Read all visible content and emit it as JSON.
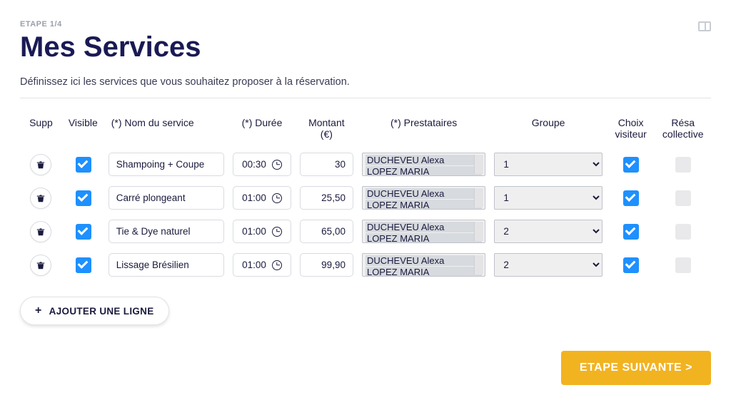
{
  "step_label": "ETAPE 1/4",
  "page_title": "Mes Services",
  "subtitle": "Définissez ici les services que vous souhaitez proposer à la réservation.",
  "columns": {
    "supp": "Supp",
    "visible": "Visible",
    "nom": "(*) Nom du service",
    "duree": "(*) Durée",
    "montant_l1": "Montant",
    "montant_l2": "(€)",
    "prestataires": "(*) Prestataires",
    "groupe": "Groupe",
    "choix_l1": "Choix",
    "choix_l2": "visiteur",
    "resa_l1": "Résa",
    "resa_l2": "collective"
  },
  "groupe_options": [
    "1",
    "2"
  ],
  "prestataires_options": [
    "DUCHEVEU Alexa",
    "LOPEZ MARIA"
  ],
  "rows": [
    {
      "visible": true,
      "nom": "Shampoing + Coupe",
      "duree": "00:30",
      "montant": "30",
      "prestataires": [
        "DUCHEVEU Alexa",
        "LOPEZ MARIA"
      ],
      "groupe": "1",
      "choix_visiteur": true,
      "resa_collective": false
    },
    {
      "visible": true,
      "nom": "Carré plongeant",
      "duree": "01:00",
      "montant": "25,50",
      "prestataires": [
        "DUCHEVEU Alexa",
        "LOPEZ MARIA"
      ],
      "groupe": "1",
      "choix_visiteur": true,
      "resa_collective": false
    },
    {
      "visible": true,
      "nom": "Tie & Dye naturel",
      "duree": "01:00",
      "montant": "65,00",
      "prestataires": [
        "DUCHEVEU Alexa",
        "LOPEZ MARIA"
      ],
      "groupe": "2",
      "choix_visiteur": true,
      "resa_collective": false
    },
    {
      "visible": true,
      "nom": "Lissage Brésilien",
      "duree": "01:00",
      "montant": "99,90",
      "prestataires": [
        "DUCHEVEU Alexa",
        "LOPEZ MARIA"
      ],
      "groupe": "2",
      "choix_visiteur": true,
      "resa_collective": false
    }
  ],
  "add_row_label": "AJOUTER UNE LIGNE",
  "next_label": "ETAPE SUIVANTE >"
}
